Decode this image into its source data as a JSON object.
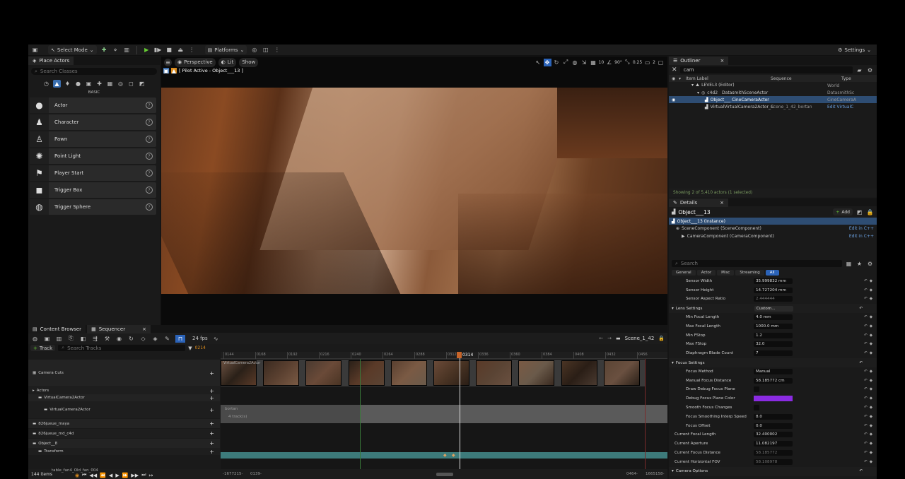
{
  "toolbar": {
    "mode": "Select Mode",
    "platforms": "Platforms",
    "settings": "Settings"
  },
  "place_actors": {
    "tab": "Place Actors",
    "search_placeholder": "Search Classes",
    "category": "BASIC",
    "items": [
      {
        "label": "Actor",
        "icon": "sphere-icon"
      },
      {
        "label": "Character",
        "icon": "character-icon"
      },
      {
        "label": "Pawn",
        "icon": "pawn-icon"
      },
      {
        "label": "Point Light",
        "icon": "light-bulb-icon"
      },
      {
        "label": "Player Start",
        "icon": "player-start-icon"
      },
      {
        "label": "Trigger Box",
        "icon": "trigger-box-icon"
      },
      {
        "label": "Trigger Sphere",
        "icon": "trigger-sphere-icon"
      }
    ]
  },
  "viewport": {
    "perspective": "Perspective",
    "lit": "Lit",
    "show": "Show",
    "pilot": "[ Pilot Active - Object___13 ]",
    "fov": "90°",
    "snap": "10",
    "scale": "0.25",
    "speed": "2"
  },
  "outliner": {
    "tab": "Outliner",
    "search_value": "cam",
    "col_label": "Item Label",
    "col_sequence": "Sequence",
    "col_type": "Type",
    "rows": [
      {
        "label": "LEVEL3 (Editor)",
        "sequence": "",
        "type": "World",
        "indent": 0
      },
      {
        "label": "c4d2",
        "sequence": "",
        "type": "DatasmithSc",
        "sub": "DatasmithSceneActor",
        "indent": 1
      },
      {
        "label": "Object___ CineCameraActor",
        "sequence": "",
        "type": "CineCameraA",
        "indent": 2,
        "selected": true
      },
      {
        "label": "VirtualVirtualCamera2Actor_C",
        "sequence": "Scene_1_42_bortan",
        "type": "Edit VirtualC",
        "indent": 2
      }
    ],
    "status": "Showing 2 of 5,410 actors (1 selected)"
  },
  "details": {
    "tab": "Details",
    "object": "Object___13",
    "add": "Add",
    "instance": "Object___13 (Instance)",
    "components": [
      {
        "label": "SceneComponent (SceneComponent)",
        "action": "Edit in C++"
      },
      {
        "label": "CameraComponent (CameraComponent)",
        "action": "Edit in C++"
      }
    ],
    "search_placeholder": "Search",
    "filters": [
      "General",
      "Actor",
      "Misc",
      "Streaming",
      "All"
    ],
    "props": [
      {
        "type": "prop",
        "k": "Sensor Width",
        "v": "35.999832 mm"
      },
      {
        "type": "prop",
        "k": "Sensor Height",
        "v": "14.727204 mm"
      },
      {
        "type": "prop",
        "k": "Sensor Aspect Ratio",
        "v": "2.444444"
      },
      {
        "type": "cat",
        "k": "Lens Settings",
        "v": "Custom..."
      },
      {
        "type": "prop",
        "k": "Min Focal Length",
        "v": "4.0 mm"
      },
      {
        "type": "prop",
        "k": "Max Focal Length",
        "v": "1000.0 mm"
      },
      {
        "type": "prop",
        "k": "Min FStop",
        "v": "1.2"
      },
      {
        "type": "prop",
        "k": "Max FStop",
        "v": "32.0"
      },
      {
        "type": "prop",
        "k": "Diaphragm Blade Count",
        "v": "7"
      },
      {
        "type": "cat",
        "k": "Focus Settings",
        "v": ""
      },
      {
        "type": "prop",
        "k": "Focus Method",
        "v": "Manual"
      },
      {
        "type": "prop",
        "k": "Manual Focus Distance",
        "v": "58.185772 cm"
      },
      {
        "type": "prop",
        "k": "Draw Debug Focus Plane",
        "v": ""
      },
      {
        "type": "prop",
        "k": "Debug Focus Plane Color",
        "v": ""
      },
      {
        "type": "prop",
        "k": "Smooth Focus Changes",
        "v": ""
      },
      {
        "type": "prop",
        "k": "Focus Smoothing Interp Speed",
        "v": "8.0"
      },
      {
        "type": "prop",
        "k": "Focus Offset",
        "v": "0.0"
      },
      {
        "type": "prop0",
        "k": "Current Focal Length",
        "v": "32.400002"
      },
      {
        "type": "prop0",
        "k": "Current Aperture",
        "v": "11.082197"
      },
      {
        "type": "prop0",
        "k": "Current Focus Distance",
        "v": "58.185772"
      },
      {
        "type": "prop0",
        "k": "Current Horizontal FOV",
        "v": "58.108978"
      },
      {
        "type": "cat",
        "k": "Camera Options",
        "v": ""
      }
    ]
  },
  "bottom": {
    "tab_content": "Content Browser",
    "tab_sequencer": "Sequencer",
    "fps": "24 fps",
    "scene": "Scene_1_42",
    "track_btn": "Track",
    "search_placeholder": "Search Tracks",
    "frame_current": "0214",
    "playhead": "0314",
    "ticks": [
      "0144",
      "0168",
      "0192",
      "0216",
      "0240",
      "0264",
      "0288",
      "0312",
      "0336",
      "0360",
      "0384",
      "0408",
      "0432",
      "0456"
    ],
    "tracks": [
      {
        "label": "Camera Cuts",
        "indent": 0
      },
      {
        "label": "Actors",
        "indent": 0
      },
      {
        "label": "VirtualCamera2Actor",
        "indent": 1
      },
      {
        "label": "VirtualCamera2Actor",
        "indent": 2
      },
      {
        "label": "826jueue_maya",
        "indent": 0
      },
      {
        "label": "826jueue_md_c4d",
        "indent": 0
      },
      {
        "label": "Object__8",
        "indent": 0
      },
      {
        "label": "Transform",
        "indent": 1
      }
    ],
    "clip_label": "VirtualCamera2Actor",
    "section_name": "bortan",
    "section_tracks": "4 track(s)",
    "items_count": "144 items",
    "items_path": "table_fan4_Old_fan_004",
    "range_start": "-1677215-",
    "range_in": "0139-",
    "range_out": "0464-",
    "range_end": "1665158-"
  }
}
